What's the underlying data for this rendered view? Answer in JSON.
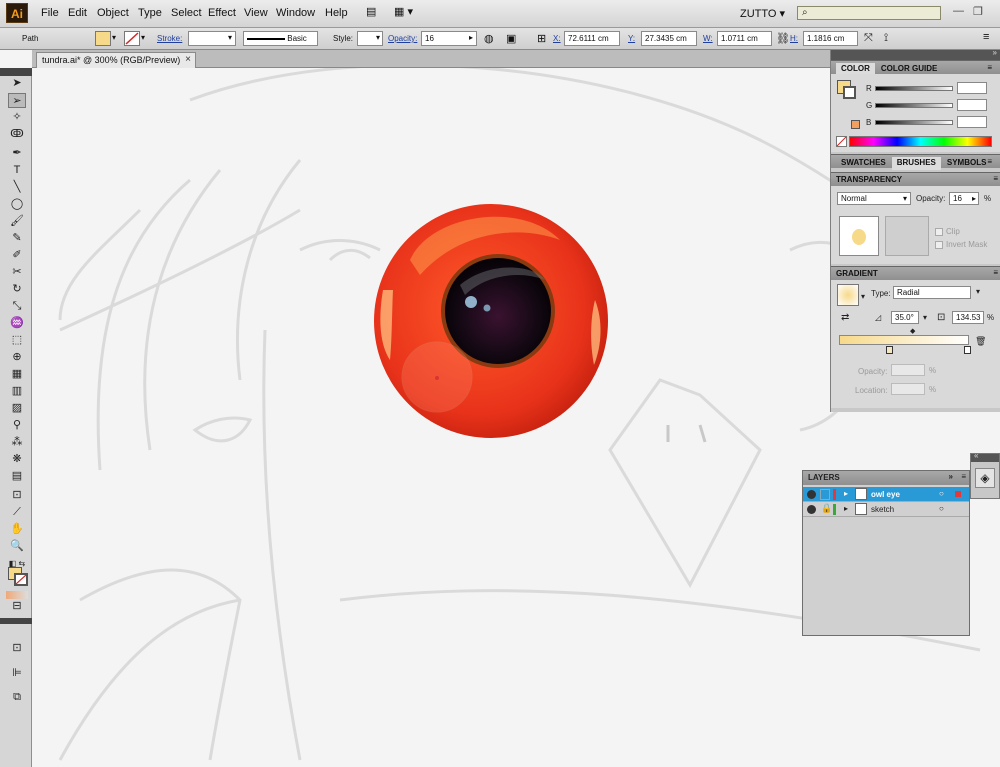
{
  "app": {
    "logo": "Ai",
    "workspace": "ZUTTO",
    "search_placeholder": ""
  },
  "menu": [
    "File",
    "Edit",
    "Object",
    "Type",
    "Select",
    "Effect",
    "View",
    "Window",
    "Help"
  ],
  "control_bar": {
    "selection": "Path",
    "stroke_label": "Stroke:",
    "brush_label": "Basic",
    "style_label": "Style:",
    "opacity_label": "Opacity:",
    "opacity_value": "16",
    "x_label": "X:",
    "x_value": "72.6111 cm",
    "y_label": "Y:",
    "y_value": "27.3435 cm",
    "w_label": "W:",
    "w_value": "1.0711 cm",
    "h_label": "H:",
    "h_value": "1.1816 cm"
  },
  "document_tab": {
    "title": "tundra.ai* @ 300% (RGB/Preview)",
    "close": "×"
  },
  "color_panel": {
    "tabs": [
      "COLOR",
      "COLOR GUIDE"
    ],
    "channels": [
      "R",
      "G",
      "B"
    ]
  },
  "swatches_group": {
    "tabs": [
      "SWATCHES",
      "BRUSHES",
      "SYMBOLS"
    ]
  },
  "transparency_panel": {
    "title": "TRANSPARENCY",
    "blend_mode": "Normal",
    "opacity_label": "Opacity:",
    "opacity_value": "16",
    "percent": "%",
    "clip_label": "Clip",
    "invert_mask_label": "Invert Mask"
  },
  "gradient_panel": {
    "title": "GRADIENT",
    "type_label": "Type:",
    "type_value": "Radial",
    "angle_value": "35.0°",
    "aspect_value": "134.53",
    "percent": "%",
    "opacity_label": "Opacity:",
    "location_label": "Location:"
  },
  "layers_panel": {
    "title": "LAYERS",
    "layers": [
      {
        "name": "owl eye",
        "selected": true,
        "color": "#e23a3a"
      },
      {
        "name": "sketch",
        "selected": false,
        "color": "#3aa83a"
      }
    ]
  },
  "colors": {
    "accent": "#2a9ad6",
    "eye_red": "#e8321a",
    "gradient_start": "#f7d98a"
  }
}
